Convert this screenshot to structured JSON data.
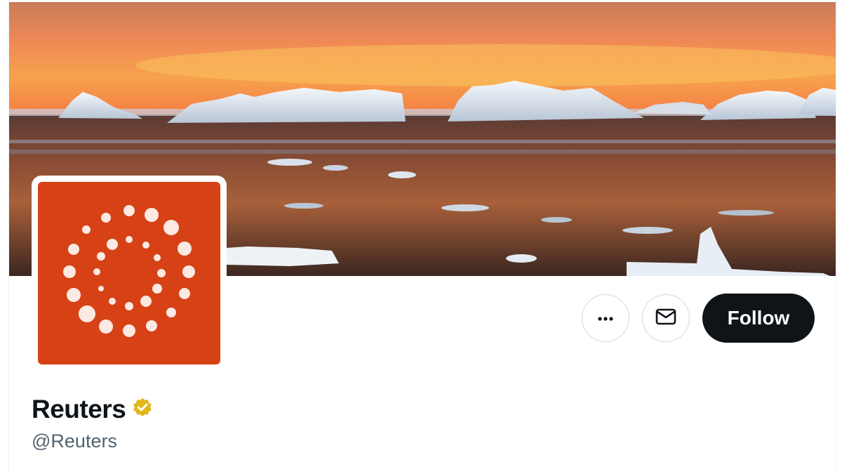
{
  "profile": {
    "display_name": "Reuters",
    "handle": "@Reuters",
    "verified": true,
    "verified_badge_color": "#e2b719",
    "avatar_bg_color": "#d64116",
    "banner_description": "arctic sunset icebergs photo"
  },
  "actions": {
    "more_icon": "more-horizontal-icon",
    "message_icon": "envelope-icon",
    "follow_label": "Follow"
  },
  "colors": {
    "text_primary": "#0f1419",
    "text_secondary": "#536471",
    "follow_bg": "#0f1419"
  }
}
